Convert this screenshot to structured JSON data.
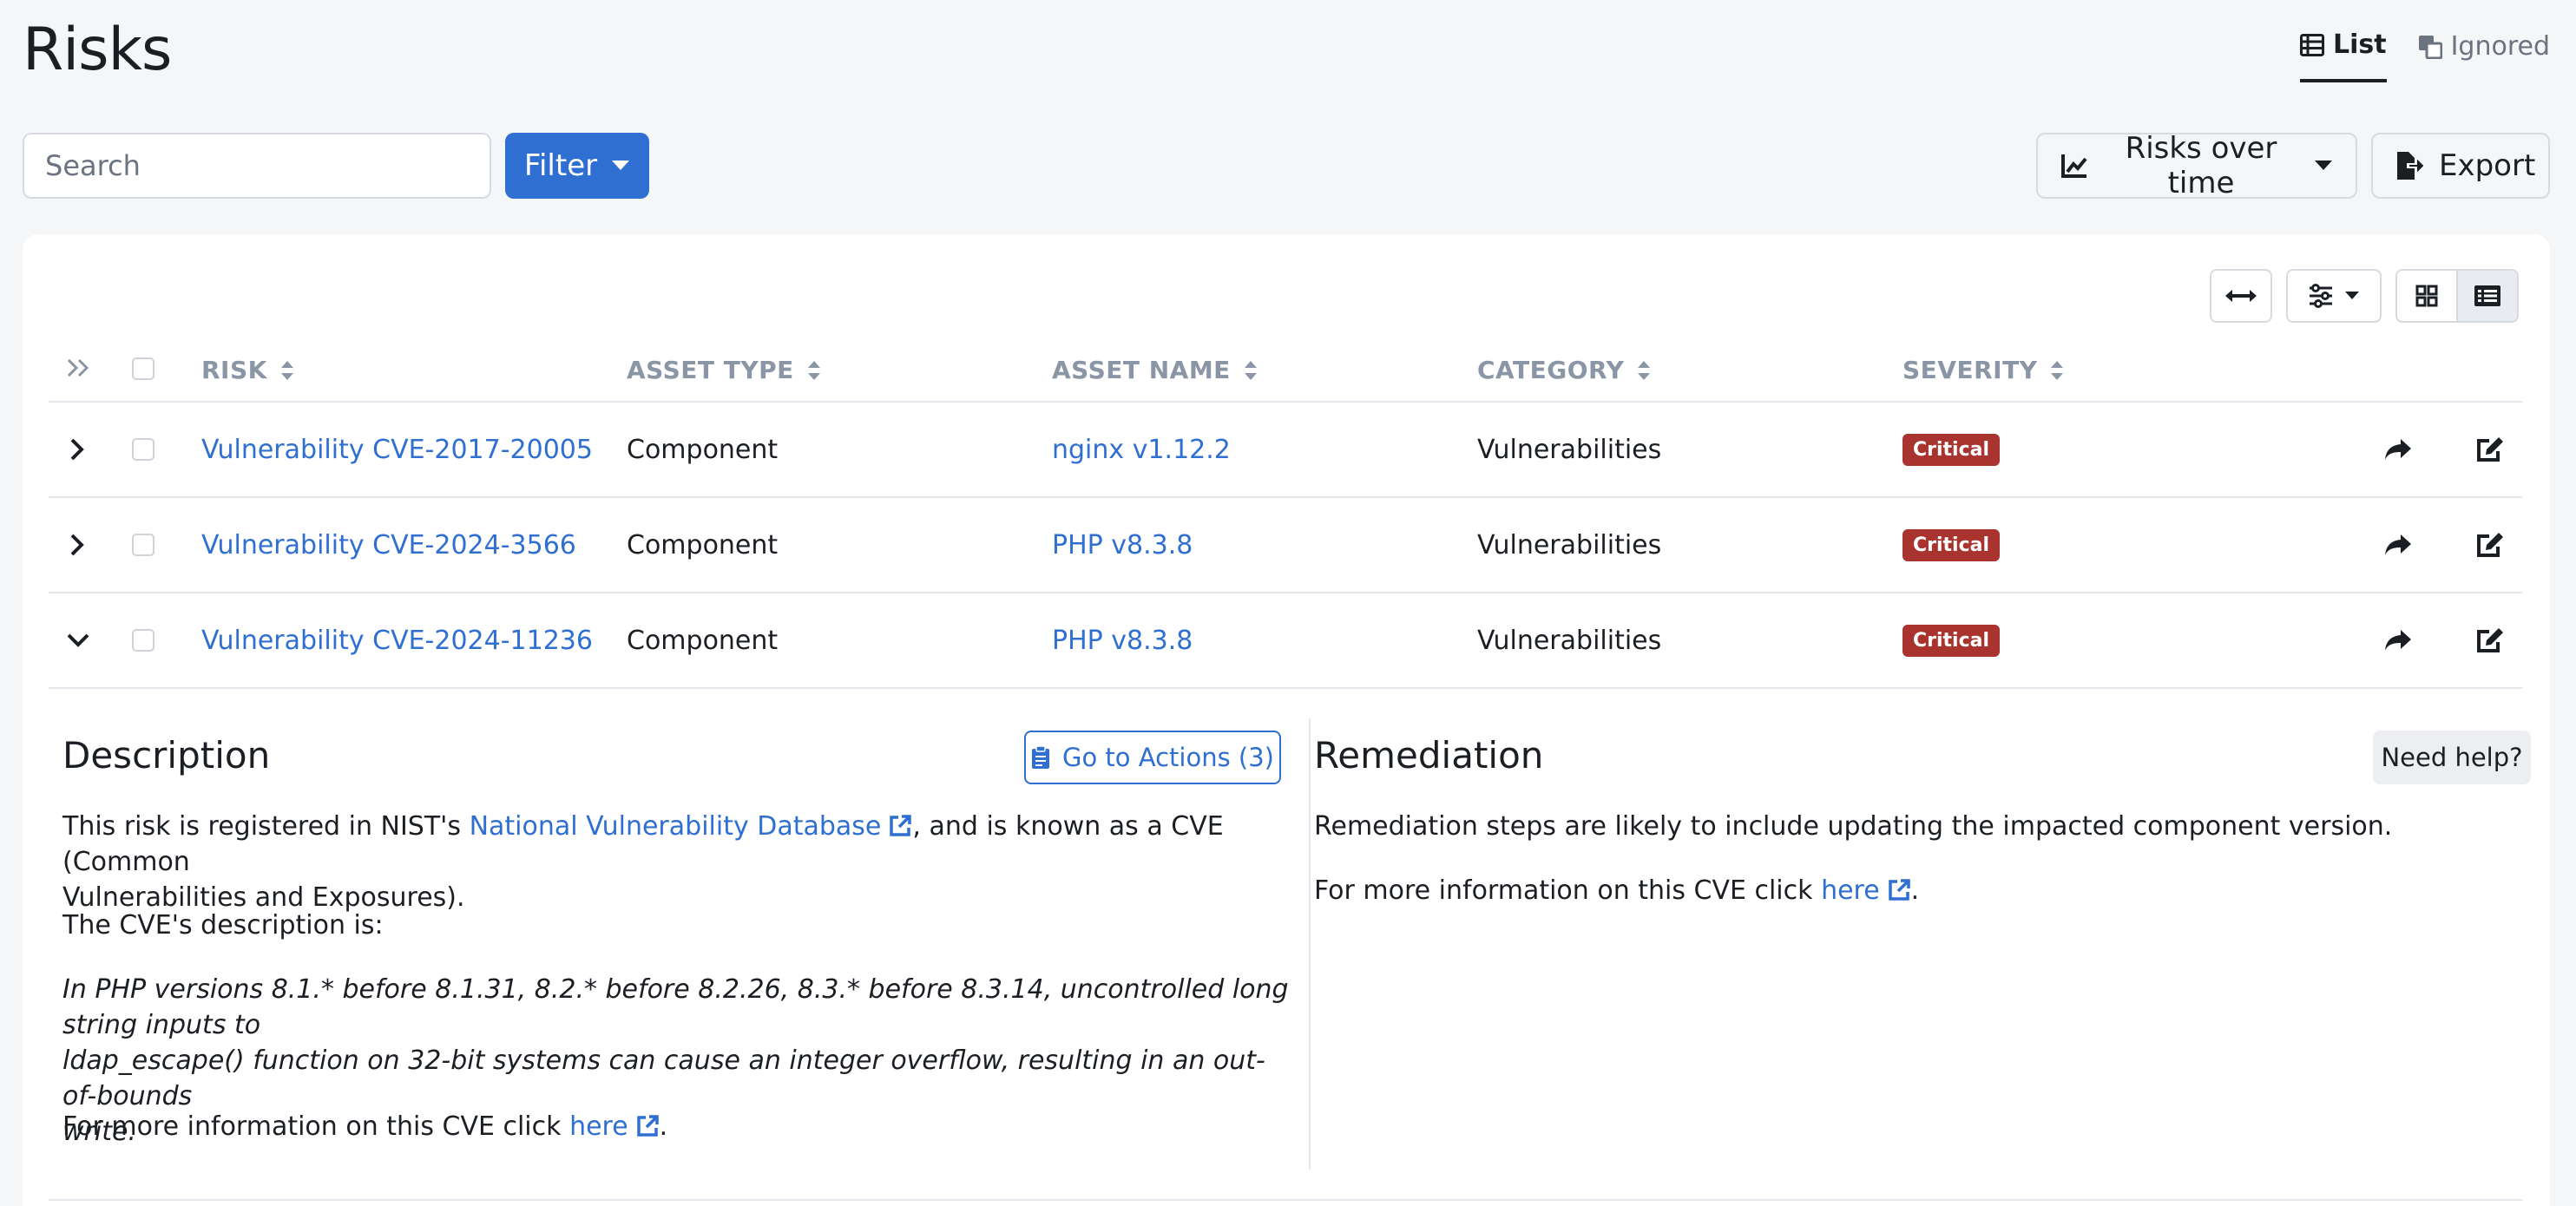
{
  "header": {
    "title": "Risks",
    "tabs": [
      {
        "label": "List",
        "icon": "list-icon",
        "active": true
      },
      {
        "label": "Ignored",
        "icon": "ignored-icon",
        "active": false
      }
    ]
  },
  "toolbar": {
    "search_placeholder": "Search",
    "filter_label": "Filter",
    "risks_over_time_label": "Risks over time",
    "export_label": "Export"
  },
  "table": {
    "columns": [
      "RISK",
      "ASSET TYPE",
      "ASSET NAME",
      "CATEGORY",
      "SEVERITY"
    ],
    "rows": [
      {
        "risk": "Vulnerability CVE-2017-20005",
        "asset_type": "Component",
        "asset_name": "nginx v1.12.2",
        "category": "Vulnerabilities",
        "severity": "Critical",
        "expanded": false
      },
      {
        "risk": "Vulnerability CVE-2024-3566",
        "asset_type": "Component",
        "asset_name": "PHP v8.3.8",
        "category": "Vulnerabilities",
        "severity": "Critical",
        "expanded": false
      },
      {
        "risk": "Vulnerability CVE-2024-11236",
        "asset_type": "Component",
        "asset_name": "PHP v8.3.8",
        "category": "Vulnerabilities",
        "severity": "Critical",
        "expanded": true
      }
    ]
  },
  "detail": {
    "description_title": "Description",
    "actions_button": "Go to Actions (3)",
    "intro_prefix": "This risk is registered in NIST's ",
    "intro_link": "National Vulnerability Database",
    "intro_suffix_line1": ", and is known as a CVE (Common",
    "intro_line2": "Vulnerabilities and Exposures).",
    "cve_intro": "The CVE's description is:",
    "cve_desc_line1": "In PHP versions 8.1.* before 8.1.31, 8.2.* before 8.2.26, 8.3.* before 8.3.14, uncontrolled long string inputs to",
    "cve_desc_line2": "ldap_escape() function on 32-bit systems can cause an integer overflow, resulting in an out-of-bounds",
    "cve_desc_line3": "write.",
    "more_info_prefix": "For more information on this CVE click ",
    "more_info_link": "here",
    "more_info_suffix": ".",
    "remediation_title": "Remediation",
    "help_button": "Need help?",
    "remediation_text": "Remediation steps are likely to include updating the impacted component version.",
    "remediation_more_prefix": "For more information on this CVE click ",
    "remediation_more_link": "here",
    "remediation_more_suffix": "."
  },
  "colors": {
    "accent": "#2f6fd1",
    "critical": "#a8332f",
    "muted_header": "#8a95a5"
  }
}
